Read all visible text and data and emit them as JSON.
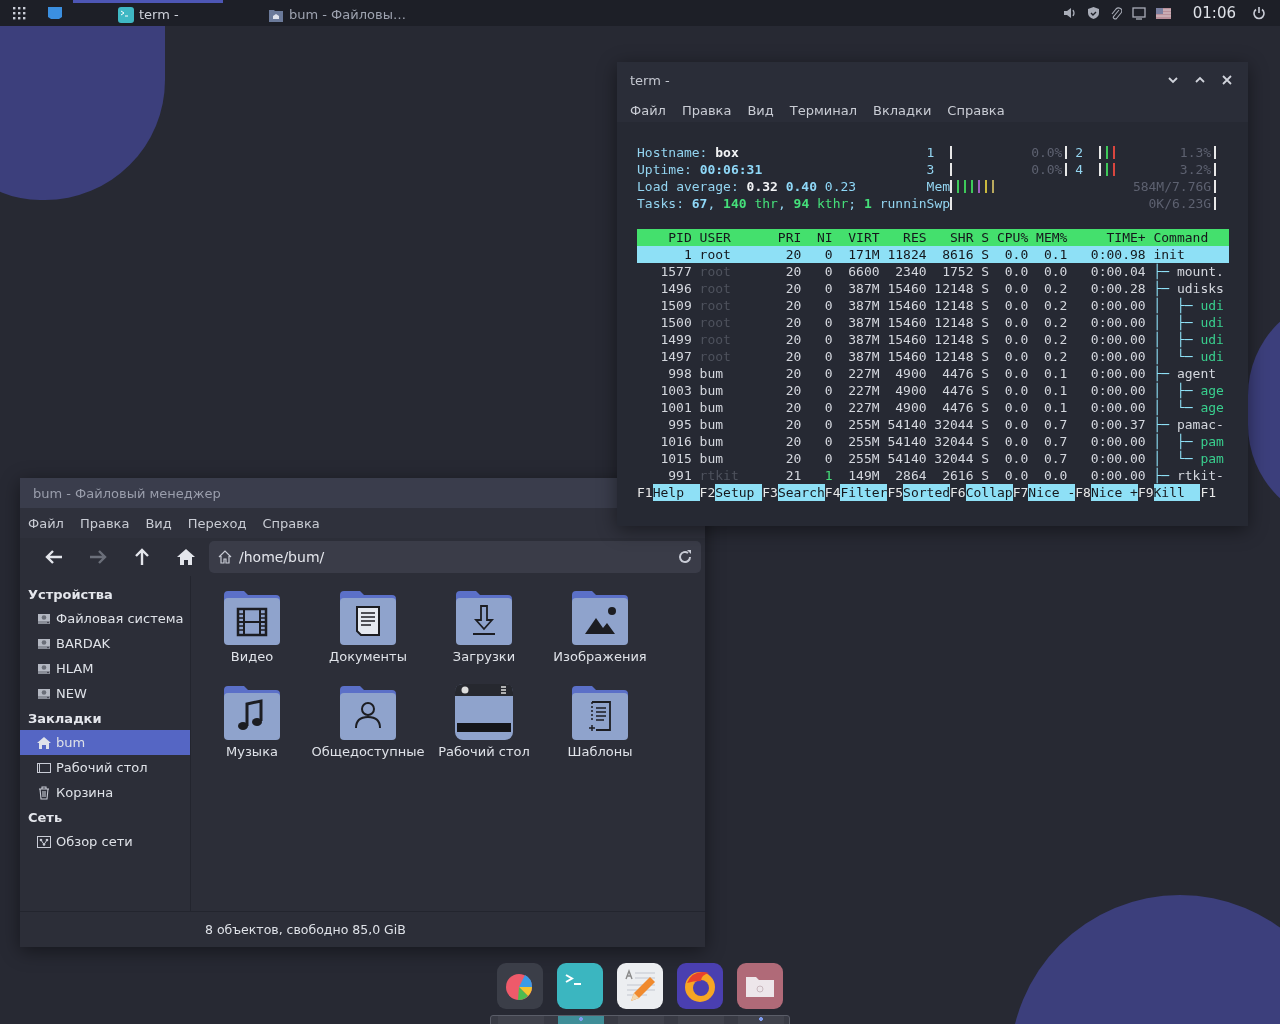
{
  "panel": {
    "tasks": [
      {
        "label": "term -",
        "selected": true,
        "kind": "terminal"
      },
      {
        "label": "bum - Файловы…",
        "selected": false,
        "kind": "files"
      }
    ],
    "clock": "01:06"
  },
  "terminal": {
    "title": "term -",
    "menu": [
      "Файл",
      "Правка",
      "Вид",
      "Терминал",
      "Вкладки",
      "Справка"
    ],
    "header": [
      [
        {
          "text": "Hostname: ",
          "kind": "label"
        },
        {
          "text": "box",
          "kind": "strong"
        }
      ],
      [
        {
          "text": "Uptime: ",
          "kind": "label"
        },
        {
          "text": "00:06:31",
          "kind": "accent-bold"
        }
      ],
      [
        {
          "text": "Load average: ",
          "kind": "label"
        },
        {
          "text": "0.32 ",
          "kind": "strong"
        },
        {
          "text": "0.40 ",
          "kind": "accent-bold"
        },
        {
          "text": "0.23",
          "kind": "accent"
        }
      ],
      [
        {
          "text": "Tasks: ",
          "kind": "label"
        },
        {
          "text": "67",
          "kind": "accent-bold"
        },
        {
          "text": ", ",
          "kind": "label"
        },
        {
          "text": "140",
          "kind": "green-bold"
        },
        {
          "text": " thr",
          "kind": "green"
        },
        {
          "text": ", ",
          "kind": "label"
        },
        {
          "text": "94",
          "kind": "green-bold"
        },
        {
          "text": " kthr",
          "kind": "green"
        },
        {
          "text": "; ",
          "kind": "label"
        },
        {
          "text": "1",
          "kind": "green-bold"
        },
        {
          "text": " runnin",
          "kind": "label"
        }
      ]
    ],
    "cpus": [
      {
        "label": "1",
        "reading": "0.0%"
      },
      {
        "label": "2",
        "bars": [
          {
            "color": "#3ec95a"
          },
          {
            "color": "#d9463f"
          }
        ],
        "reading": "1.3%"
      },
      {
        "label": "3",
        "reading": "0.0%"
      },
      {
        "label": "4",
        "bars": [
          {
            "color": "#3ec95a"
          },
          {
            "color": "#d9463f"
          }
        ],
        "reading": "3.2%"
      }
    ],
    "memory": [
      {
        "label": "Mem",
        "bars": [
          {
            "color": "#3ec95a"
          },
          {
            "color": "#3ec95a"
          },
          {
            "color": "#3ec95a"
          },
          {
            "color": "#a05fc0"
          },
          {
            "color": "#c9b93e"
          },
          {
            "color": "#b9a95e"
          }
        ],
        "reading": "584M/7.76G"
      },
      {
        "label": "Swp",
        "reading": "0K/6.23G"
      }
    ],
    "columns": [
      "PID",
      "USER",
      "PRI",
      "NI",
      "VIRT",
      "RES",
      "SHR",
      "S",
      "CPU%",
      "MEM%",
      "TIME+",
      "Command"
    ],
    "rows": [
      {
        "cells": [
          "1",
          "root",
          "20",
          "0",
          "171M",
          "11824",
          "8616",
          "S",
          "0.0",
          "0.1",
          "0:00.98"
        ],
        "tree": "",
        "command": "init",
        "selected": true,
        "user_dim": false,
        "nice_raised": false,
        "thread": false
      },
      {
        "cells": [
          "1577",
          "root",
          "20",
          "0",
          "6600",
          "2340",
          "1752",
          "S",
          "0.0",
          "0.0",
          "0:00.04"
        ],
        "tree": "├─ ",
        "command": "mount.",
        "selected": false,
        "user_dim": true,
        "nice_raised": false,
        "thread": false
      },
      {
        "cells": [
          "1496",
          "root",
          "20",
          "0",
          "387M",
          "15460",
          "12148",
          "S",
          "0.0",
          "0.2",
          "0:00.28"
        ],
        "tree": "├─ ",
        "command": "udisks",
        "selected": false,
        "user_dim": true,
        "nice_raised": false,
        "thread": false
      },
      {
        "cells": [
          "1509",
          "root",
          "20",
          "0",
          "387M",
          "15460",
          "12148",
          "S",
          "0.0",
          "0.2",
          "0:00.00"
        ],
        "tree": "│  ├─ ",
        "command": "udi",
        "selected": false,
        "user_dim": true,
        "nice_raised": false,
        "thread": true
      },
      {
        "cells": [
          "1500",
          "root",
          "20",
          "0",
          "387M",
          "15460",
          "12148",
          "S",
          "0.0",
          "0.2",
          "0:00.00"
        ],
        "tree": "│  ├─ ",
        "command": "udi",
        "selected": false,
        "user_dim": true,
        "nice_raised": false,
        "thread": true
      },
      {
        "cells": [
          "1499",
          "root",
          "20",
          "0",
          "387M",
          "15460",
          "12148",
          "S",
          "0.0",
          "0.2",
          "0:00.00"
        ],
        "tree": "│  ├─ ",
        "command": "udi",
        "selected": false,
        "user_dim": true,
        "nice_raised": false,
        "thread": true
      },
      {
        "cells": [
          "1497",
          "root",
          "20",
          "0",
          "387M",
          "15460",
          "12148",
          "S",
          "0.0",
          "0.2",
          "0:00.00"
        ],
        "tree": "│  └─ ",
        "command": "udi",
        "selected": false,
        "user_dim": true,
        "nice_raised": false,
        "thread": true
      },
      {
        "cells": [
          "998",
          "bum",
          "20",
          "0",
          "227M",
          "4900",
          "4476",
          "S",
          "0.0",
          "0.1",
          "0:00.00"
        ],
        "tree": "├─ ",
        "command": "agent",
        "selected": false,
        "user_dim": false,
        "nice_raised": false,
        "thread": false
      },
      {
        "cells": [
          "1003",
          "bum",
          "20",
          "0",
          "227M",
          "4900",
          "4476",
          "S",
          "0.0",
          "0.1",
          "0:00.00"
        ],
        "tree": "│  ├─ ",
        "command": "age",
        "selected": false,
        "user_dim": false,
        "nice_raised": false,
        "thread": true
      },
      {
        "cells": [
          "1001",
          "bum",
          "20",
          "0",
          "227M",
          "4900",
          "4476",
          "S",
          "0.0",
          "0.1",
          "0:00.00"
        ],
        "tree": "│  └─ ",
        "command": "age",
        "selected": false,
        "user_dim": false,
        "nice_raised": false,
        "thread": true
      },
      {
        "cells": [
          "995",
          "bum",
          "20",
          "0",
          "255M",
          "54140",
          "32044",
          "S",
          "0.0",
          "0.7",
          "0:00.37"
        ],
        "tree": "├─ ",
        "command": "pamac-",
        "selected": false,
        "user_dim": false,
        "nice_raised": false,
        "thread": false
      },
      {
        "cells": [
          "1016",
          "bum",
          "20",
          "0",
          "255M",
          "54140",
          "32044",
          "S",
          "0.0",
          "0.7",
          "0:00.00"
        ],
        "tree": "│  ├─ ",
        "command": "pam",
        "selected": false,
        "user_dim": false,
        "nice_raised": false,
        "thread": true
      },
      {
        "cells": [
          "1015",
          "bum",
          "20",
          "0",
          "255M",
          "54140",
          "32044",
          "S",
          "0.0",
          "0.7",
          "0:00.00"
        ],
        "tree": "│  └─ ",
        "command": "pam",
        "selected": false,
        "user_dim": false,
        "nice_raised": false,
        "thread": true
      },
      {
        "cells": [
          "991",
          "rtkit",
          "21",
          "1",
          "149M",
          "2864",
          "2616",
          "S",
          "0.0",
          "0.0",
          "0:00.00"
        ],
        "tree": "├─ ",
        "command": "rtkit-",
        "selected": false,
        "user_dim": true,
        "nice_raised": true,
        "thread": false
      }
    ],
    "fkeys": [
      {
        "key": "F1",
        "label": "Help"
      },
      {
        "key": "F2",
        "label": "Setup"
      },
      {
        "key": "F3",
        "label": "Search"
      },
      {
        "key": "F4",
        "label": "Filter"
      },
      {
        "key": "F5",
        "label": "Sorted"
      },
      {
        "key": "F6",
        "label": "Collap"
      },
      {
        "key": "F7",
        "label": "Nice -"
      },
      {
        "key": "F8",
        "label": "Nice +"
      },
      {
        "key": "F9",
        "label": "Kill"
      },
      {
        "key": "F1"
      }
    ]
  },
  "files": {
    "title": "bum - Файловый менеджер",
    "menu": [
      "Файл",
      "Правка",
      "Вид",
      "Переход",
      "Справка"
    ],
    "nav": [
      {
        "kind": "back",
        "disabled": false
      },
      {
        "kind": "forward",
        "disabled": true
      },
      {
        "kind": "up",
        "disabled": false
      },
      {
        "kind": "home",
        "disabled": false
      }
    ],
    "path": "/home/bum/",
    "sidebar": [
      {
        "title": "Устройства",
        "items": [
          {
            "label": "Файловая система",
            "kind": "drive",
            "selected": false
          },
          {
            "label": "BARDAK",
            "kind": "drive",
            "selected": false
          },
          {
            "label": "HLAM",
            "kind": "drive",
            "selected": false
          },
          {
            "label": "NEW",
            "kind": "drive",
            "selected": false
          }
        ]
      },
      {
        "title": "Закладки",
        "items": [
          {
            "label": "bum",
            "kind": "home",
            "selected": true
          },
          {
            "label": "Рабочий стол",
            "kind": "desktop",
            "selected": false
          },
          {
            "label": "Корзина",
            "kind": "trash",
            "selected": false
          }
        ]
      },
      {
        "title": "Сеть",
        "items": [
          {
            "label": "Обзор сети",
            "kind": "network",
            "selected": false
          }
        ]
      }
    ],
    "folders": [
      {
        "label": "Видео",
        "kind": "video"
      },
      {
        "label": "Документы",
        "kind": "documents"
      },
      {
        "label": "Загрузки",
        "kind": "downloads"
      },
      {
        "label": "Изображения",
        "kind": "images"
      },
      {
        "label": "Музыка",
        "kind": "music"
      },
      {
        "label": "Общедоступные",
        "kind": "public"
      },
      {
        "label": "Рабочий стол",
        "kind": "desktop"
      },
      {
        "label": "Шаблоны",
        "kind": "templates"
      }
    ],
    "status": "8 объектов, свободно 85,0 GiB"
  },
  "dock": [
    {
      "kind": "chart",
      "running": false,
      "active": false
    },
    {
      "kind": "terminal",
      "running": true,
      "active": true
    },
    {
      "kind": "editor",
      "running": false,
      "active": false
    },
    {
      "kind": "browser",
      "running": false,
      "active": false
    },
    {
      "kind": "files",
      "running": true,
      "active": false
    }
  ]
}
